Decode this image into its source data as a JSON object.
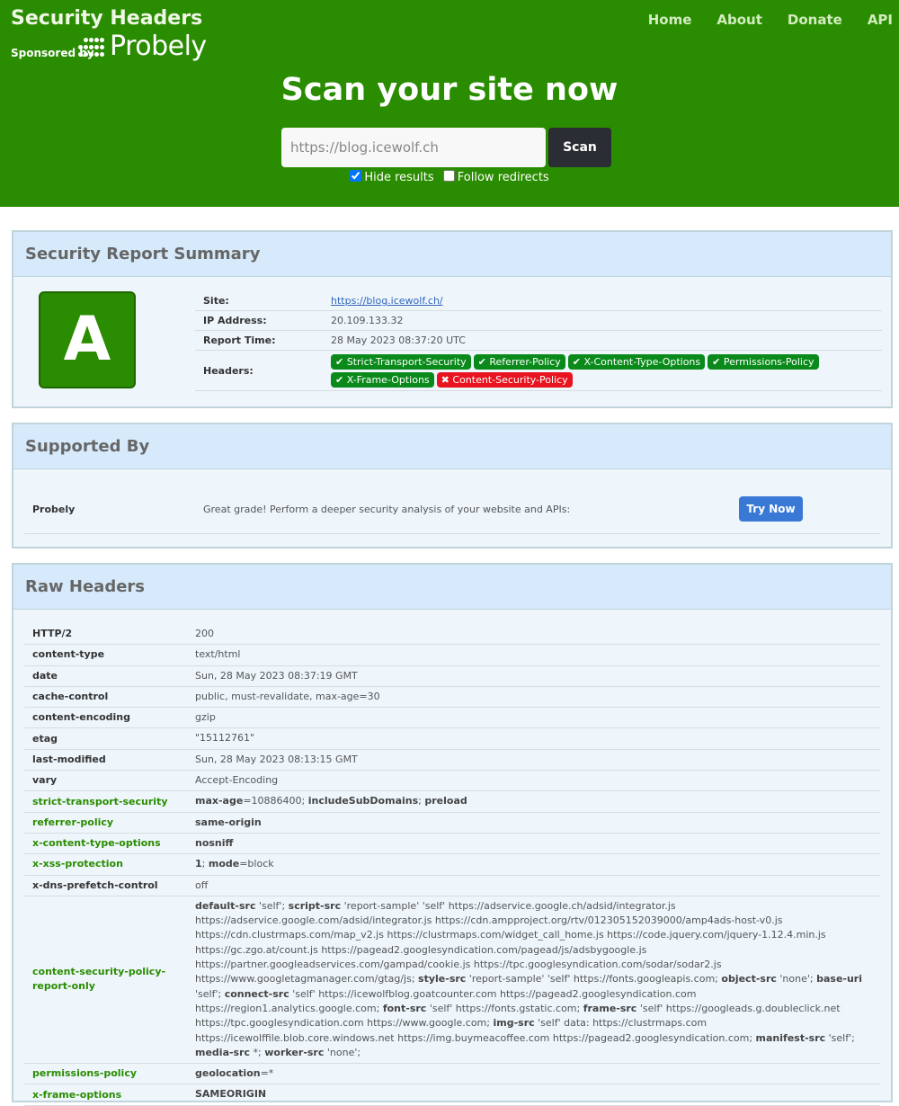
{
  "brand": {
    "title": "Security Headers",
    "sponsored_by": "Sponsored by",
    "sponsor_name": "Probely"
  },
  "nav": [
    "Home",
    "About",
    "Donate",
    "API"
  ],
  "scan": {
    "title": "Scan your site now",
    "placeholder": "https://blog.icewolf.ch",
    "button": "Scan",
    "hide_results": "Hide results",
    "hide_results_checked": true,
    "follow_redirects": "Follow redirects",
    "follow_redirects_checked": false
  },
  "summary": {
    "title": "Security Report Summary",
    "grade": "A",
    "rows": [
      {
        "label": "Site:",
        "value": "https://blog.icewolf.ch/"
      },
      {
        "label": "IP Address:",
        "value": "20.109.133.32"
      },
      {
        "label": "Report Time:",
        "value": "28 May 2023 08:37:20 UTC"
      },
      {
        "label": "Headers:"
      }
    ],
    "headers": [
      {
        "name": "Strict-Transport-Security",
        "status": "present"
      },
      {
        "name": "Referrer-Policy",
        "status": "present"
      },
      {
        "name": "X-Content-Type-Options",
        "status": "present"
      },
      {
        "name": "Permissions-Policy",
        "status": "present"
      },
      {
        "name": "X-Frame-Options",
        "status": "present"
      },
      {
        "name": "Content-Security-Policy",
        "status": "missing"
      }
    ]
  },
  "supported": {
    "title": "Supported By",
    "name": "Probely",
    "description": "Great grade! Perform a deeper security analysis of your website and APIs:",
    "button": "Try Now"
  },
  "raw": {
    "title": "Raw Headers",
    "rows": [
      {
        "key": "HTTP/2",
        "value": "200",
        "security": false
      },
      {
        "key": "content-type",
        "value": "text/html",
        "security": false
      },
      {
        "key": "date",
        "value": "Sun, 28 May 2023 08:37:19 GMT",
        "security": false
      },
      {
        "key": "cache-control",
        "value": "public, must-revalidate, max-age=30",
        "security": false
      },
      {
        "key": "content-encoding",
        "value": "gzip",
        "security": false
      },
      {
        "key": "etag",
        "value": "\"15112761\"",
        "security": false
      },
      {
        "key": "last-modified",
        "value": "Sun, 28 May 2023 08:13:15 GMT",
        "security": false
      },
      {
        "key": "vary",
        "value": "Accept-Encoding",
        "security": false
      },
      {
        "key": "strict-transport-security",
        "value": "max-age=10886400; includeSubDomains; preload",
        "security": true
      },
      {
        "key": "referrer-policy",
        "value": "same-origin",
        "security": true
      },
      {
        "key": "x-content-type-options",
        "value": "nosniff",
        "security": true
      },
      {
        "key": "x-xss-protection",
        "value": "1; mode=block",
        "security": true
      },
      {
        "key": "x-dns-prefetch-control",
        "value": "off",
        "security": false
      },
      {
        "key": "content-security-policy-report-only",
        "value": "default-src 'self'; script-src 'report-sample' 'self' https://adservice.google.ch/adsid/integrator.js https://adservice.google.com/adsid/integrator.js https://cdn.ampproject.org/rtv/012305152039000/amp4ads-host-v0.js https://cdn.clustrmaps.com/map_v2.js https://clustrmaps.com/widget_call_home.js https://code.jquery.com/jquery-1.12.4.min.js https://gc.zgo.at/count.js https://pagead2.googlesyndication.com/pagead/js/adsbygoogle.js https://partner.googleadservices.com/gampad/cookie.js https://tpc.googlesyndication.com/sodar/sodar2.js https://www.googletagmanager.com/gtag/js; style-src 'report-sample' 'self' https://fonts.googleapis.com; object-src 'none'; base-uri 'self'; connect-src 'self' https://icewolfblog.goatcounter.com https://pagead2.googlesyndication.com https://region1.analytics.google.com; font-src 'self' https://fonts.gstatic.com; frame-src 'self' https://googleads.g.doubleclick.net https://tpc.googlesyndication.com https://www.google.com; img-src 'self' data: https://clustrmaps.com https://icewolffile.blob.core.windows.net https://img.buymeacoffee.com https://pagead2.googlesyndication.com; manifest-src 'self'; media-src *; worker-src 'none';",
        "security": true
      },
      {
        "key": "permissions-policy",
        "value": "geolocation=*",
        "security": true
      },
      {
        "key": "x-frame-options",
        "value": "SAMEORIGIN",
        "security": true
      }
    ]
  },
  "colors": {
    "header_bg": "#2a8c00",
    "grade_bg": "#2a8c00",
    "badge_ok": "#0a8a1a",
    "badge_bad": "#e8141f",
    "panel_head": "#d7eafb",
    "panel_body": "#eef6fc",
    "button_primary": "#3a78d6"
  },
  "icons": {
    "present": "check-icon",
    "missing": "cross-icon"
  }
}
